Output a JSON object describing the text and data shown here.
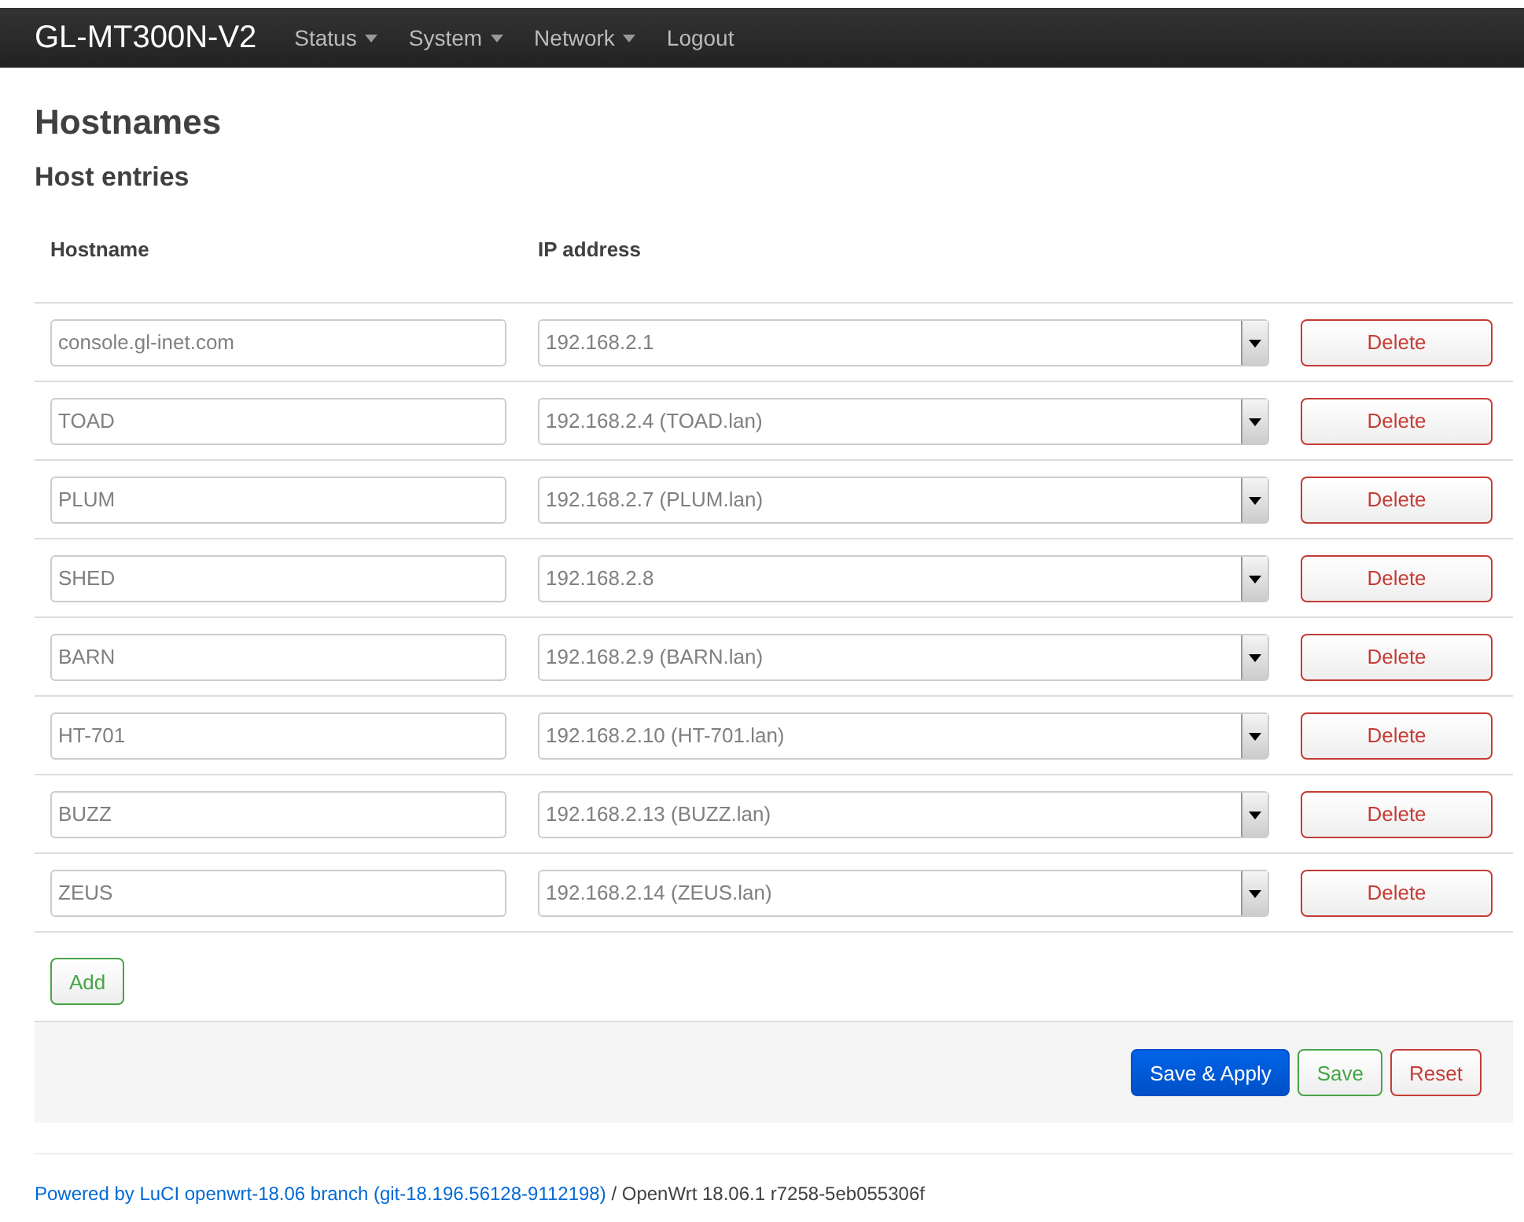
{
  "brand": "GL-MT300N-V2",
  "menu": [
    {
      "label": "Status",
      "dropdown": true
    },
    {
      "label": "System",
      "dropdown": true
    },
    {
      "label": "Network",
      "dropdown": true
    },
    {
      "label": "Logout",
      "dropdown": false
    }
  ],
  "title": "Hostnames",
  "section": "Host entries",
  "columns": [
    "Hostname",
    "IP address"
  ],
  "rows": [
    {
      "hostname": "console.gl-inet.com",
      "ip": "192.168.2.1",
      "action": "Delete"
    },
    {
      "hostname": "TOAD",
      "ip": "192.168.2.4 (TOAD.lan)",
      "action": "Delete"
    },
    {
      "hostname": "PLUM",
      "ip": "192.168.2.7 (PLUM.lan)",
      "action": "Delete"
    },
    {
      "hostname": "SHED",
      "ip": "192.168.2.8",
      "action": "Delete"
    },
    {
      "hostname": "BARN",
      "ip": "192.168.2.9 (BARN.lan)",
      "action": "Delete"
    },
    {
      "hostname": "HT-701",
      "ip": "192.168.2.10 (HT-701.lan)",
      "action": "Delete"
    },
    {
      "hostname": "BUZZ",
      "ip": "192.168.2.13 (BUZZ.lan)",
      "action": "Delete"
    },
    {
      "hostname": "ZEUS",
      "ip": "192.168.2.14 (ZEUS.lan)",
      "action": "Delete"
    }
  ],
  "add_button": "Add",
  "actions": [
    {
      "label": "Save & Apply",
      "kind": "primary"
    },
    {
      "label": "Save",
      "kind": "positive"
    },
    {
      "label": "Reset",
      "kind": "negative"
    }
  ],
  "footer": {
    "link": "Powered by LuCI openwrt-18.06 branch (git-18.196.56128-9112198)",
    "text": "/ OpenWrt 18.06.1 r7258-5eb055306f"
  }
}
